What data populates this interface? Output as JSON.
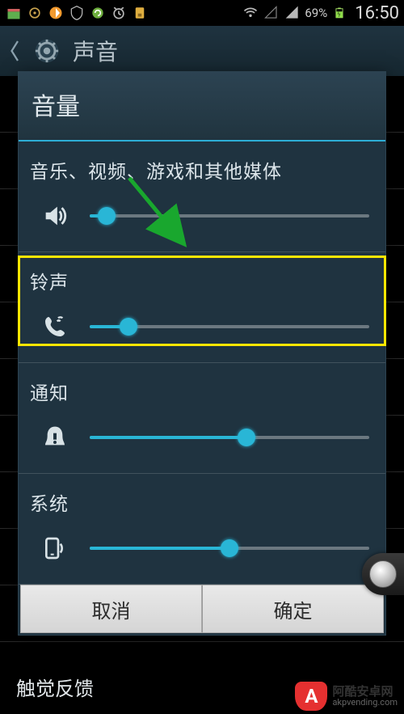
{
  "statusbar": {
    "battery_text": "69%",
    "time": "16:50"
  },
  "actionbar": {
    "title": "声音"
  },
  "dialog": {
    "title": "音量",
    "sections": [
      {
        "label": "音乐、视频、游戏和其他媒体",
        "value_pct": 6
      },
      {
        "label": "铃声",
        "value_pct": 14
      },
      {
        "label": "通知",
        "value_pct": 56
      },
      {
        "label": "系统",
        "value_pct": 50
      }
    ],
    "cancel": "取消",
    "ok": "确定"
  },
  "background_row": "触觉反馈",
  "watermark": {
    "badge": "A",
    "name": "阿酷安卓网",
    "url": "akpvending.com"
  }
}
